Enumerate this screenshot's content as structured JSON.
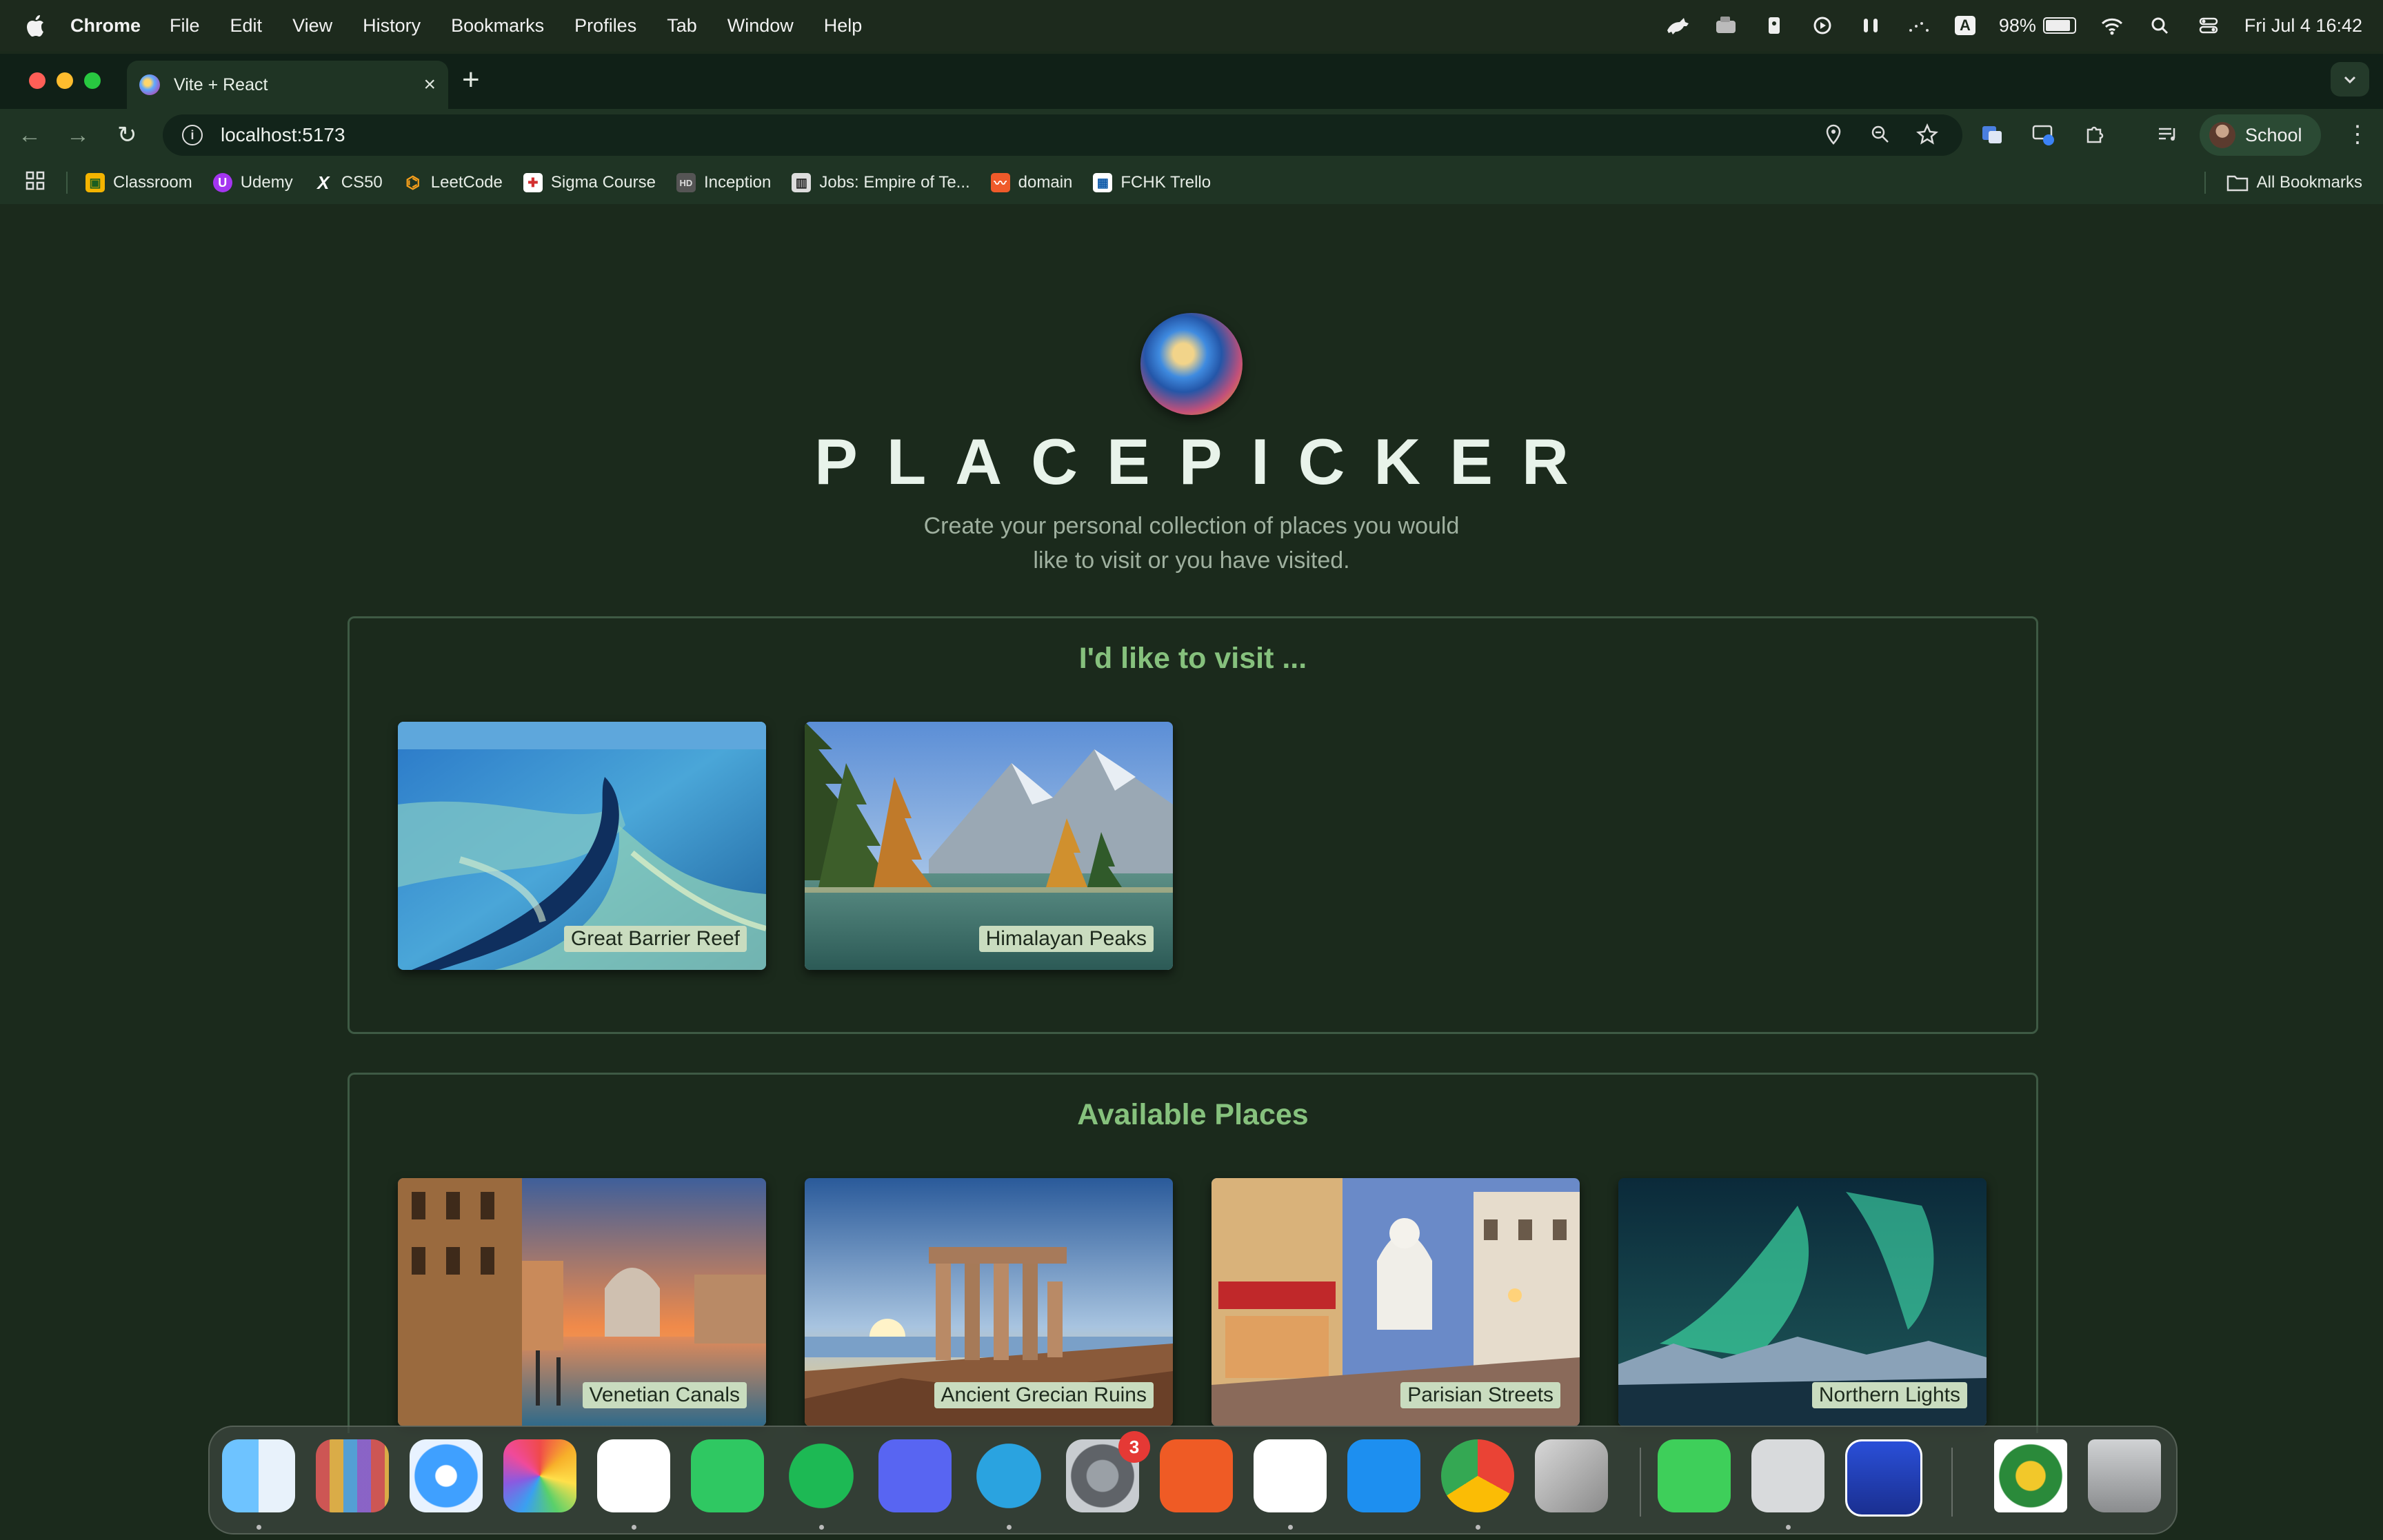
{
  "menubar": {
    "app_name": "Chrome",
    "menus": [
      "File",
      "Edit",
      "View",
      "History",
      "Bookmarks",
      "Profiles",
      "Tab",
      "Window",
      "Help"
    ],
    "battery_percent": "98%",
    "battery_level": 0.98,
    "keyboard_input": "A",
    "datetime": "Fri Jul 4  16:42"
  },
  "browser": {
    "tab_title": "Vite + React",
    "tab_close": "×",
    "new_tab": "+",
    "url": "localhost:5173",
    "profile_label": "School",
    "bookmarks": [
      {
        "label": "Classroom",
        "color": "#f4b400"
      },
      {
        "label": "Udemy",
        "color": "#a435f0"
      },
      {
        "label": "CS50",
        "color": "#222222"
      },
      {
        "label": "LeetCode",
        "color": "#f89f1b"
      },
      {
        "label": "Sigma Course",
        "color": "#d32f2f"
      },
      {
        "label": "Inception",
        "color": "#555555"
      },
      {
        "label": "Jobs: Empire of Te...",
        "color": "#3b3b3b"
      },
      {
        "label": "domain",
        "color": "#ef5a2a"
      },
      {
        "label": "FCHK Trello",
        "color": "#0b58a8"
      }
    ],
    "all_bookmarks": "All Bookmarks"
  },
  "page": {
    "title": "PLACEPICKER",
    "tagline": "Create your personal collection of places you would like to visit or you have visited.",
    "sections": {
      "visit": {
        "heading": "I'd like to visit ...",
        "places": [
          "Great Barrier Reef",
          "Himalayan Peaks"
        ]
      },
      "available": {
        "heading": "Available Places",
        "places": [
          "Venetian Canals",
          "Ancient Grecian Ruins",
          "Parisian Streets",
          "Northern Lights"
        ]
      }
    }
  },
  "dock": {
    "apps": [
      "finder",
      "launchpad",
      "safari",
      "photos",
      "slack",
      "whatsapp",
      "spotify",
      "discord",
      "telegram",
      "system-settings",
      "postman",
      "vscode",
      "docker",
      "chrome",
      "iphone-mirroring",
      "facetime",
      "parallels",
      "preview",
      "school-app",
      "trash"
    ],
    "settings_badge": "3"
  },
  "colors": {
    "page_background": "#1b2a1c",
    "heading_green": "#86c17d",
    "label_background": "#c9dcbf"
  }
}
